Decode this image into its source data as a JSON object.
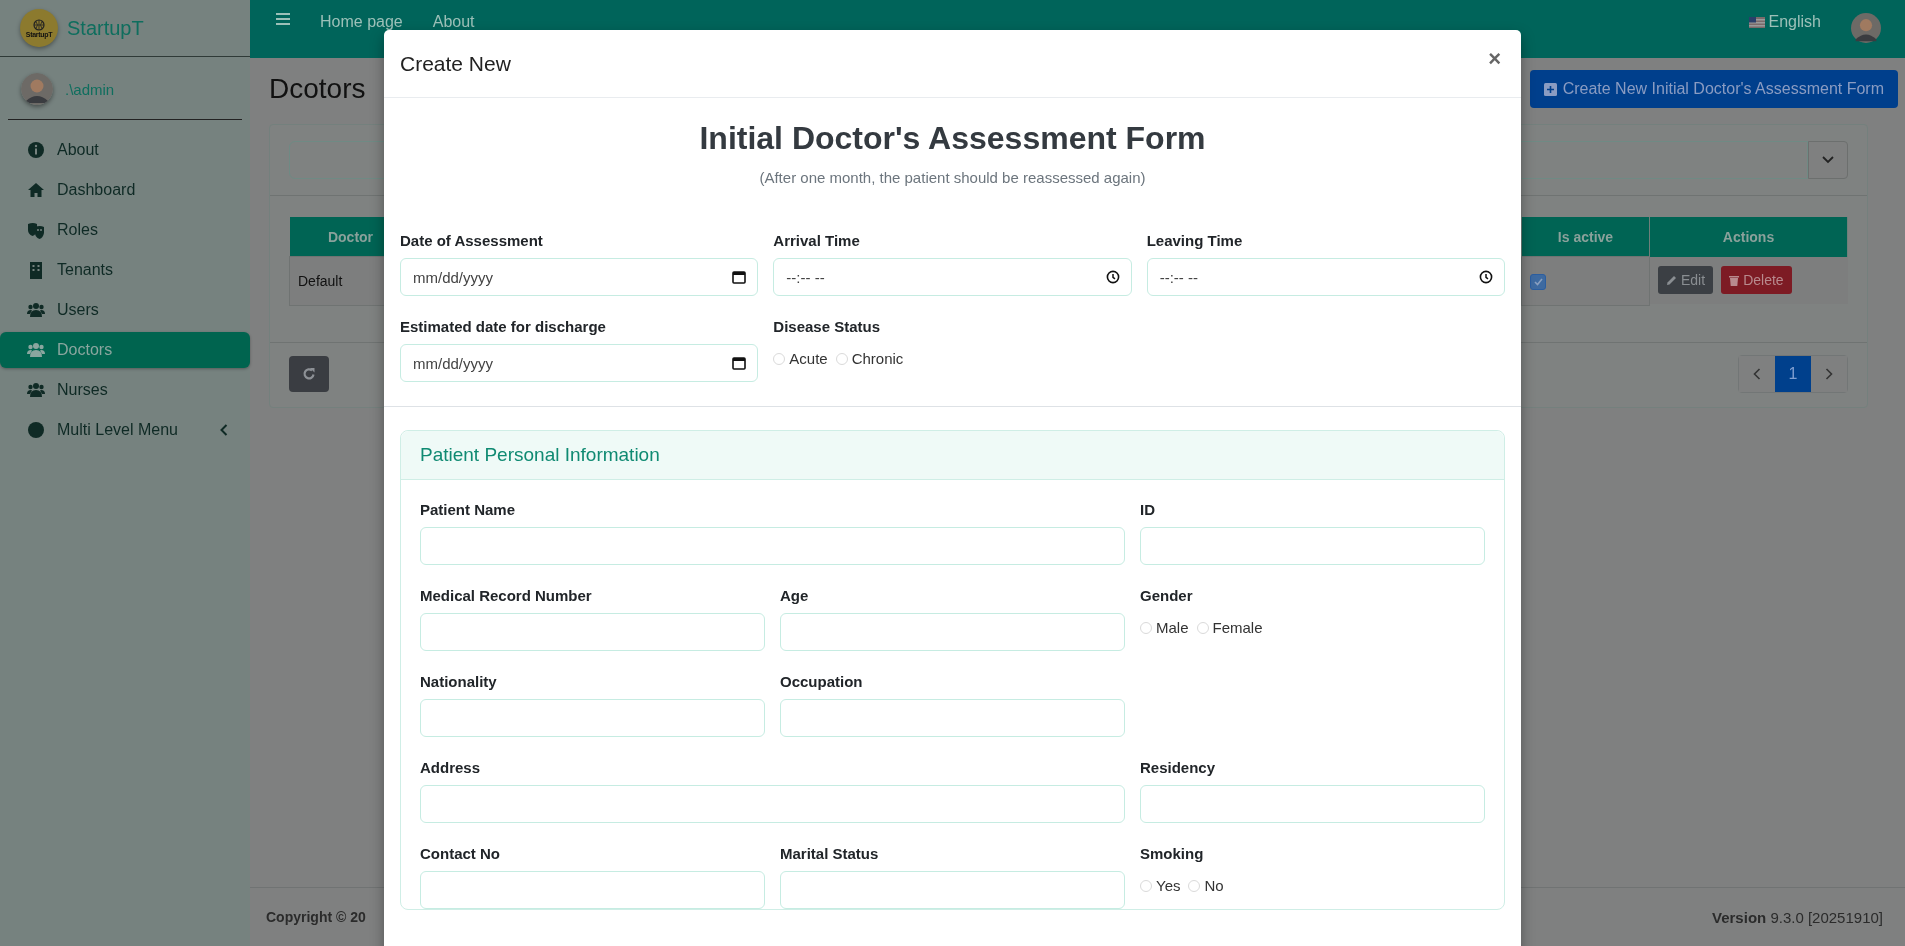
{
  "sidebar": {
    "logo_text": "StartupT",
    "brand": "StartupT",
    "user": ".\\admin",
    "items": [
      {
        "label": "About",
        "kind": "link",
        "selected": false
      },
      {
        "label": "Dashboard",
        "kind": "link",
        "selected": false
      },
      {
        "label": "Roles",
        "kind": "link",
        "selected": false
      },
      {
        "label": "Tenants",
        "kind": "link",
        "selected": false
      },
      {
        "label": "Users",
        "kind": "link",
        "selected": false
      },
      {
        "label": "Doctors",
        "kind": "link",
        "selected": true
      },
      {
        "label": "Nurses",
        "kind": "link",
        "selected": false
      },
      {
        "label": "Multi Level Menu",
        "kind": "submenu",
        "selected": false
      }
    ]
  },
  "topbar": {
    "nav": [
      "Home page",
      "About"
    ],
    "language": "English"
  },
  "page": {
    "title": "Dcotors",
    "create_button": "Create New Initial Doctor's Assessment Form",
    "table": {
      "columns": [
        "Doctor",
        "Is active",
        "Actions"
      ],
      "rows": [
        {
          "doctor": "Default",
          "is_active": true
        }
      ]
    },
    "row_actions": [
      {
        "label": "Edit",
        "kind": "edit"
      },
      {
        "label": "Delete",
        "kind": "delete"
      }
    ],
    "pagination": [
      {
        "label": "1",
        "selected": true
      }
    ]
  },
  "footer": {
    "copyright": "Copyright © 20",
    "version_label": "Version",
    "version": "9.3.0 [20251910]"
  },
  "modal": {
    "title": "Create New",
    "close": "×",
    "heading": "Initial Doctor's Assessment Form",
    "subtitle": "(After one month, the patient should be reassessed again)",
    "rows": [
      [
        {
          "kind": "date",
          "label": "Date of Assessment",
          "placeholder": "mm/dd/yyyy"
        },
        {
          "kind": "time",
          "label": "Arrival Time",
          "placeholder": "--:-- --"
        },
        {
          "kind": "time",
          "label": "Leaving Time",
          "placeholder": "--:-- --"
        }
      ],
      [
        {
          "kind": "date",
          "label": "Estimated date for discharge",
          "placeholder": "mm/dd/yyyy"
        },
        {
          "kind": "radio",
          "label": "Disease Status",
          "options": [
            {
              "label": "Acute",
              "selected": false
            },
            {
              "label": "Chronic",
              "selected": false
            }
          ]
        }
      ]
    ],
    "section": {
      "title": "Patient Personal Information",
      "rows": [
        [
          {
            "kind": "wide_text",
            "label": "Patient Name"
          },
          {
            "kind": "text",
            "label": "ID"
          }
        ],
        [
          {
            "kind": "text",
            "label": "Medical Record Number"
          },
          {
            "kind": "text",
            "label": "Age"
          },
          {
            "kind": "radio",
            "label": "Gender",
            "options": [
              {
                "label": "Male",
                "selected": false
              },
              {
                "label": "Female",
                "selected": false
              }
            ]
          }
        ],
        [
          {
            "kind": "text",
            "label": "Nationality"
          },
          {
            "kind": "text",
            "label": "Occupation"
          }
        ],
        [
          {
            "kind": "wide_text",
            "label": "Address"
          },
          {
            "kind": "text",
            "label": "Residency"
          }
        ],
        [
          {
            "kind": "text",
            "label": "Contact No"
          },
          {
            "kind": "text",
            "label": "Marital Status"
          },
          {
            "kind": "radio",
            "label": "Smoking",
            "options": [
              {
                "label": "Yes",
                "selected": false
              },
              {
                "label": "No",
                "selected": false
              }
            ]
          }
        ]
      ]
    }
  }
}
